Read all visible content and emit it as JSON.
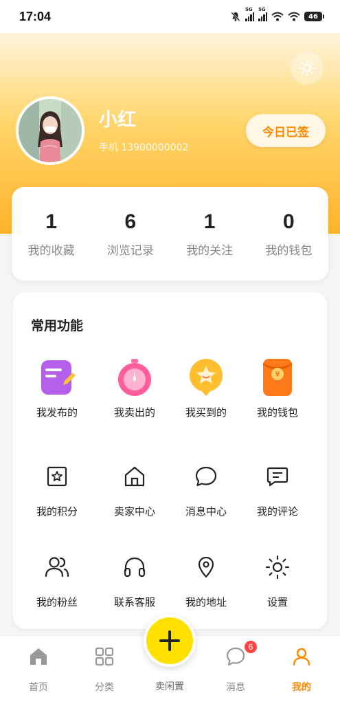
{
  "status_bar": {
    "time": "17:04",
    "signal1_tag": "5G",
    "signal2_tag": "5G",
    "battery": "46",
    "icons": [
      "mute-icon",
      "signal-icon",
      "signal-icon",
      "wifi-icon",
      "wifi-icon",
      "battery-icon"
    ]
  },
  "profile": {
    "name": "小红",
    "phone": "手机 13900000002",
    "checkin_label": "今日已签"
  },
  "stats": [
    {
      "value": "1",
      "label": "我的收藏"
    },
    {
      "value": "6",
      "label": "浏览记录"
    },
    {
      "value": "1",
      "label": "我的关注"
    },
    {
      "value": "0",
      "label": "我的钱包"
    }
  ],
  "functions": {
    "title": "常用功能",
    "items": [
      {
        "label": "我发布的",
        "icon": "note-edit-icon"
      },
      {
        "label": "我卖出的",
        "icon": "stopwatch-icon"
      },
      {
        "label": "我买到的",
        "icon": "star-bubble-icon"
      },
      {
        "label": "我的钱包",
        "icon": "red-envelope-icon"
      },
      {
        "label": "我的积分",
        "icon": "star-box-icon"
      },
      {
        "label": "卖家中心",
        "icon": "home-icon"
      },
      {
        "label": "消息中心",
        "icon": "chat-bubble-icon"
      },
      {
        "label": "我的评论",
        "icon": "comment-icon"
      },
      {
        "label": "我的粉丝",
        "icon": "users-icon"
      },
      {
        "label": "联系客服",
        "icon": "headphones-icon"
      },
      {
        "label": "我的地址",
        "icon": "location-pin-icon"
      },
      {
        "label": "设置",
        "icon": "settings-icon"
      }
    ]
  },
  "nav": {
    "home": "首页",
    "category": "分类",
    "sell": "卖闲置",
    "messages": "消息",
    "messages_badge": "6",
    "mine": "我的"
  },
  "colors": {
    "accent": "#ff8a00",
    "fab": "#ffe100",
    "badge": "#ff4242"
  }
}
